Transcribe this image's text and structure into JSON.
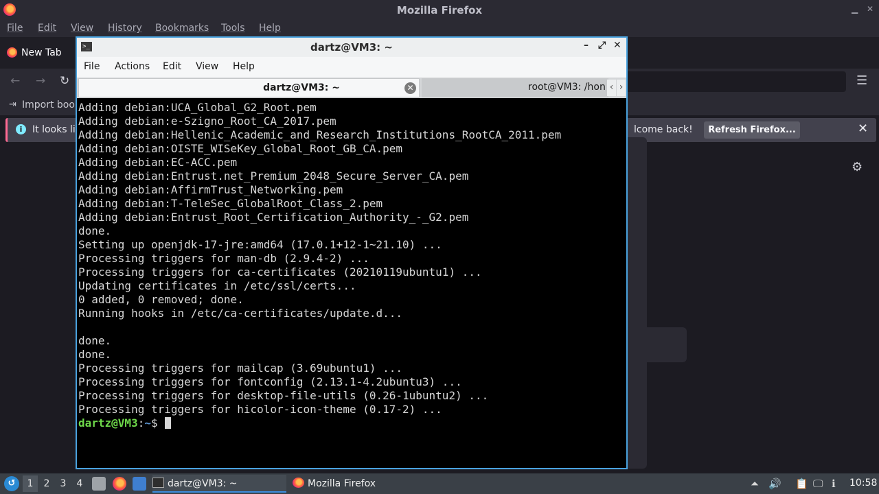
{
  "firefox": {
    "window_title": "Mozilla Firefox",
    "menu": [
      "File",
      "Edit",
      "View",
      "History",
      "Bookmarks",
      "Tools",
      "Help"
    ],
    "tab_label": "New Tab",
    "bookmark_label": "Import book",
    "notice_text": "It looks lik",
    "notice_welcome": "lcome back!",
    "refresh_button": "Refresh Firefox...",
    "colors": {
      "accent": "#ff6a93",
      "info": "#80ebff"
    }
  },
  "terminal": {
    "window_title": "dartz@VM3: ~",
    "menu": [
      "File",
      "Actions",
      "Edit",
      "View",
      "Help"
    ],
    "tabs": {
      "active": "dartz@VM3: ~",
      "inactive": "root@VM3: /hon"
    },
    "lines": [
      "Adding debian:UCA_Global_G2_Root.pem",
      "Adding debian:e-Szigno_Root_CA_2017.pem",
      "Adding debian:Hellenic_Academic_and_Research_Institutions_RootCA_2011.pem",
      "Adding debian:OISTE_WISeKey_Global_Root_GB_CA.pem",
      "Adding debian:EC-ACC.pem",
      "Adding debian:Entrust.net_Premium_2048_Secure_Server_CA.pem",
      "Adding debian:AffirmTrust_Networking.pem",
      "Adding debian:T-TeleSec_GlobalRoot_Class_2.pem",
      "Adding debian:Entrust_Root_Certification_Authority_-_G2.pem",
      "done.",
      "Setting up openjdk-17-jre:amd64 (17.0.1+12-1~21.10) ...",
      "Processing triggers for man-db (2.9.4-2) ...",
      "Processing triggers for ca-certificates (20210119ubuntu1) ...",
      "Updating certificates in /etc/ssl/certs...",
      "0 added, 0 removed; done.",
      "Running hooks in /etc/ca-certificates/update.d...",
      "",
      "done.",
      "done.",
      "Processing triggers for mailcap (3.69ubuntu1) ...",
      "Processing triggers for fontconfig (2.13.1-4.2ubuntu3) ...",
      "Processing triggers for desktop-file-utils (0.26-1ubuntu2) ...",
      "Processing triggers for hicolor-icon-theme (0.17-2) ..."
    ],
    "prompt": {
      "user": "dartz@VM3",
      "sep": ":",
      "path": "~",
      "symbol": "$ "
    },
    "colors": {
      "prompt_user": "#6ed84a",
      "prompt_path": "#5f9ad8",
      "text": "#d6d6d6"
    }
  },
  "taskbar": {
    "workspaces": [
      "1",
      "2",
      "3",
      "4"
    ],
    "tasks": [
      {
        "label": "dartz@VM3: ~",
        "icon": "terminal-icon"
      },
      {
        "label": "Mozilla Firefox",
        "icon": "firefox-icon"
      }
    ],
    "clock": "10:58"
  }
}
